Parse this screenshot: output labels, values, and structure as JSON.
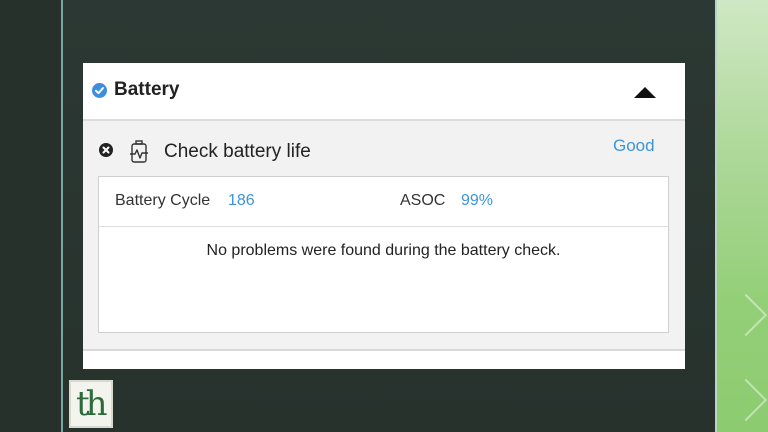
{
  "panel": {
    "title": "Battery",
    "title_icon": "check-circle-icon",
    "collapse_icon": "caret-up-icon"
  },
  "check": {
    "status_icon": "close-circle-icon",
    "icon": "battery-health-icon",
    "title": "Check battery life",
    "status": "Good"
  },
  "details": {
    "cycle_label": "Battery Cycle",
    "cycle_value": "186",
    "asoc_label": "ASOC",
    "asoc_value": "99%",
    "message": "No problems were found during the battery check."
  },
  "logo": {
    "text": "th"
  },
  "colors": {
    "accent": "#3d94d8",
    "badge": "#3d8fde",
    "background": "#2a3530",
    "panel": "#ffffff",
    "panel_body": "#f2f2f2"
  }
}
